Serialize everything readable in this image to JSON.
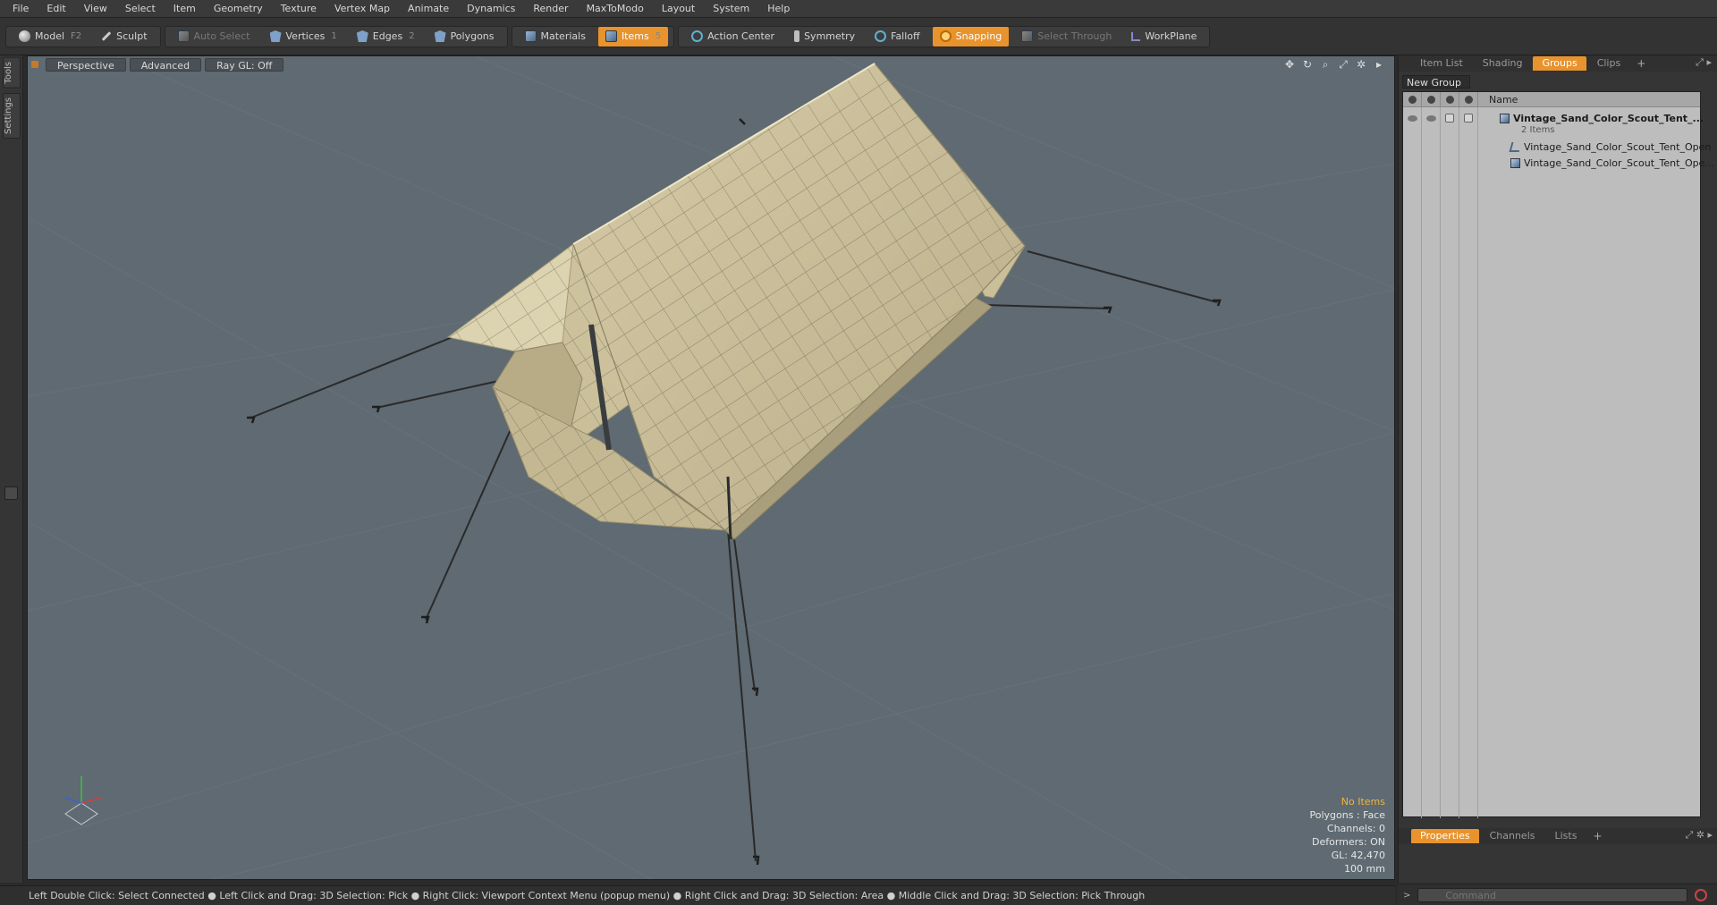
{
  "menu": [
    "File",
    "Edit",
    "View",
    "Select",
    "Item",
    "Geometry",
    "Texture",
    "Vertex Map",
    "Animate",
    "Dynamics",
    "Render",
    "MaxToModo",
    "Layout",
    "System",
    "Help"
  ],
  "toolbar": {
    "model": "Model",
    "model_key": "F2",
    "sculpt": "Sculpt",
    "auto_select": "Auto Select",
    "vertices": "Vertices",
    "vertices_key": "1",
    "edges": "Edges",
    "edges_key": "2",
    "polygons": "Polygons",
    "materials": "Materials",
    "items": "Items",
    "items_key": "5",
    "action_center": "Action Center",
    "symmetry": "Symmetry",
    "falloff": "Falloff",
    "snapping": "Snapping",
    "select_through": "Select Through",
    "workplane": "WorkPlane"
  },
  "left_tabs": [
    "Tools",
    "Settings"
  ],
  "viewport": {
    "perspective": "Perspective",
    "advanced": "Advanced",
    "raygl": "Ray GL: Off",
    "info": {
      "selection": "No Items",
      "polygons": "Polygons : Face",
      "channels": "Channels: 0",
      "deformers": "Deformers: ON",
      "gl": "GL: 42,470",
      "scale": "100 mm"
    }
  },
  "right_tabs": [
    "Item List",
    "Shading",
    "Groups",
    "Clips"
  ],
  "new_group": "New Group",
  "groups": {
    "name_header": "Name",
    "group_name": "Vintage_Sand_Color_Scout_Tent_...",
    "group_count": "2 Items",
    "child1": "Vintage_Sand_Color_Scout_Tent_Open",
    "child2": "Vintage_Sand_Color_Scout_Tent_Ope..."
  },
  "bottom_tabs": [
    "Properties",
    "Channels",
    "Lists"
  ],
  "command_placeholder": "Command",
  "status": "Left Double Click: Select Connected ● Left Click and Drag: 3D Selection: Pick ● Right Click: Viewport Context Menu (popup menu) ● Right Click and Drag: 3D Selection: Area ● Middle Click and Drag: 3D Selection: Pick Through",
  "colors": {
    "accent": "#e8932d",
    "viewport_bg": "#5f6a72",
    "tent": "#cfc49f"
  },
  "icons": {
    "move": "move-icon",
    "rotate": "rotate-icon",
    "zoom": "zoom-icon",
    "maximize": "maximize-icon",
    "settings": "gear-icon"
  }
}
